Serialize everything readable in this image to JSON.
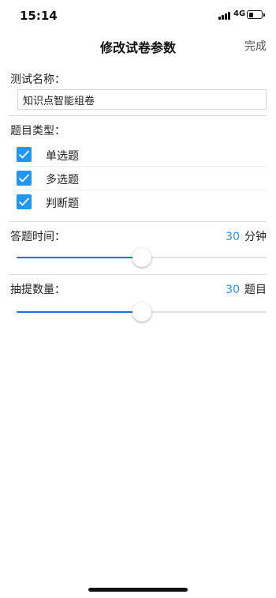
{
  "status_bar": {
    "time": "15:14",
    "network": "4G",
    "battery_level": 0.4
  },
  "nav": {
    "title": "修改试卷参数",
    "done_label": "完成"
  },
  "test_name": {
    "label": "测试名称：",
    "value": "知识点智能组卷"
  },
  "question_types": {
    "label": "题目类型：",
    "options": [
      {
        "label": "单选题",
        "checked": true
      },
      {
        "label": "多选题",
        "checked": true
      },
      {
        "label": "判断题",
        "checked": true
      }
    ]
  },
  "answer_time": {
    "label": "答题时间：",
    "value": "30",
    "unit": "分钟",
    "slider_fraction": 0.5
  },
  "question_count": {
    "label": "抽提数量：",
    "value": "30",
    "unit": "题目",
    "slider_fraction": 0.5
  },
  "colors": {
    "accent": "#2196f3",
    "slider_fill": "#1a73d9"
  },
  "icons": [
    "signal-icon",
    "battery-icon",
    "checkbox-checked-icon"
  ]
}
